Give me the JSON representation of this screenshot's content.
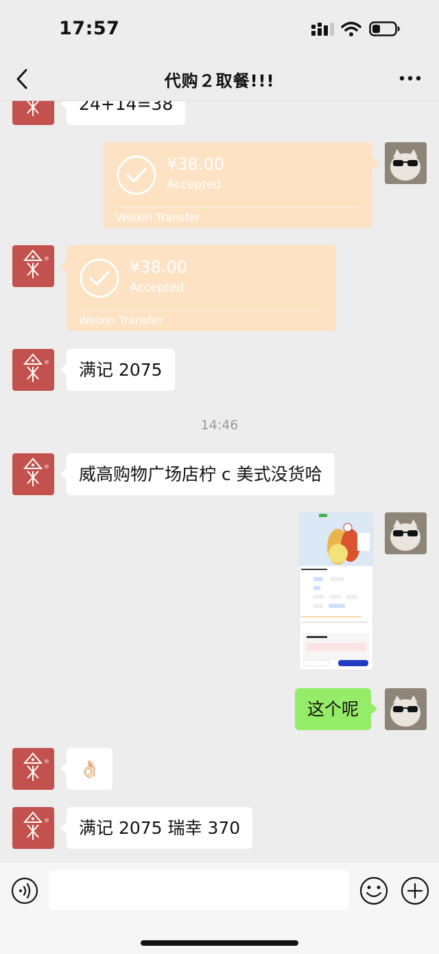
{
  "status_bar": {
    "time": "17:57"
  },
  "chat": {
    "title": "代购２取餐!!!"
  },
  "messages": {
    "m1_text": "24+14=38",
    "transfer_sent": {
      "amount": "¥38.00",
      "status": "Accepted",
      "label": "Weixin Transfer"
    },
    "transfer_received": {
      "amount": "¥38.00",
      "status": "Accepted",
      "label": "Weixin Transfer"
    },
    "m4_text": "满记 2075",
    "timestamp": "14:46",
    "m5_text": "威高购物广场店柠 c 美式没货哈",
    "screenshot": {
      "banner": "一整大杯",
      "product_title": "柠C美式",
      "options_label": "选择商品",
      "price": "¥12.9",
      "left_button": "加入购物袋",
      "right_button": "加入购物袋"
    },
    "m7_text": "这个呢",
    "m8_emoji": "👌🏻",
    "m9_text": "满记 2075 瑞幸 370"
  },
  "input": {
    "placeholder": ""
  },
  "colors": {
    "bubble_green": "#95ec69",
    "transfer": "#fde2c4",
    "background": "#ededed"
  }
}
